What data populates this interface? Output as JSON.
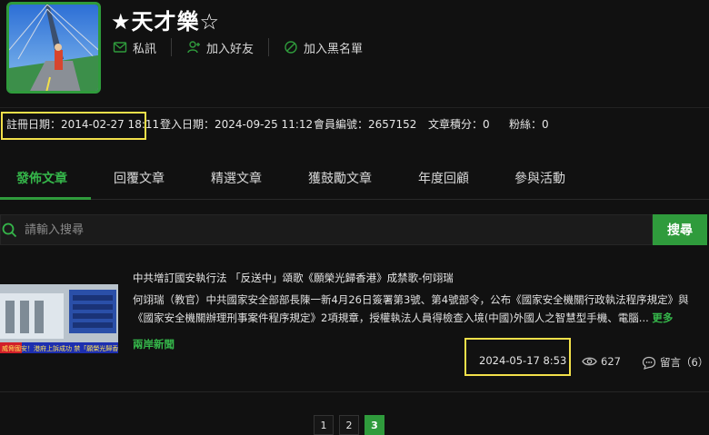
{
  "profile": {
    "username": "★天才樂☆",
    "actions": [
      {
        "label": "私訊",
        "icon": "message-icon"
      },
      {
        "label": "加入好友",
        "icon": "add-friend-icon"
      },
      {
        "label": "加入黑名單",
        "icon": "block-icon"
      }
    ]
  },
  "info": {
    "register_date": "註冊日期：2014-02-27 18:11",
    "login_date": "登入日期：2024-09-25 11:12",
    "member_no": "會員編號：2657152",
    "points": "文章積分：0",
    "fans": "粉絲：0"
  },
  "tabs": [
    {
      "label": "發佈文章",
      "active": true
    },
    {
      "label": "回覆文章",
      "active": false
    },
    {
      "label": "精選文章",
      "active": false
    },
    {
      "label": "獲鼓勵文章",
      "active": false
    },
    {
      "label": "年度回顧",
      "active": false
    },
    {
      "label": "參與活動",
      "active": false
    }
  ],
  "search": {
    "placeholder": "請輸入搜尋",
    "button": "搜尋"
  },
  "article": {
    "title": "中共增訂國安執行法 「反送中」頌歌《願榮光歸香港》成禁歌-何翊瑞",
    "excerpt": "何翊瑞（教官）中共國家安全部部長陳一新4月26日簽署第3號、第4號部令，公布《國家安全機關行政執法程序規定》與《國家安全機關辦理刑事案件程序規定》2項規章，授權執法人員得檢查入境(中國)外國人之智慧型手機、電腦...",
    "more": "更多",
    "category": "兩岸新聞",
    "date": "2024-05-17 8:53",
    "views": "627",
    "comments": "留言（6）",
    "thumb_caption": "威脅國安！港府上訴成功 禁「願榮光歸香港」"
  },
  "pagination": [
    "1",
    "2",
    "3"
  ],
  "colors": {
    "accent": "#2f9b3c",
    "accent_text": "#35b64a",
    "highlight": "#f2e04a",
    "background": "#111111"
  }
}
